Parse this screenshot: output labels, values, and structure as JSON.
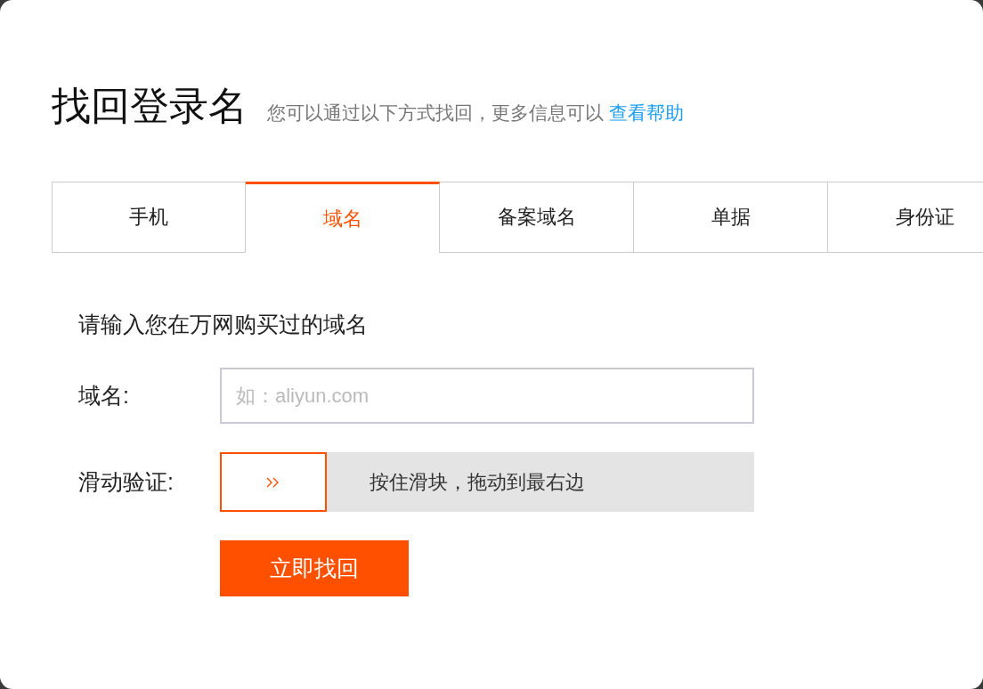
{
  "header": {
    "title": "找回登录名",
    "subtitle": "您可以通过以下方式找回，更多信息可以",
    "help_link": "查看帮助"
  },
  "tabs": [
    {
      "label": "手机",
      "selected": false
    },
    {
      "label": "域名",
      "selected": true
    },
    {
      "label": "备案域名",
      "selected": false
    },
    {
      "label": "单据",
      "selected": false
    },
    {
      "label": "身份证",
      "selected": false
    }
  ],
  "instruction": "请输入您在万网购买过的域名",
  "form": {
    "domain_label": "域名:",
    "domain_placeholder": "如：aliyun.com",
    "slider_label": "滑动验证:",
    "slider": {
      "level": 0,
      "hint": "按住滑块，拖动到最右边"
    },
    "submit": "立即找回"
  }
}
